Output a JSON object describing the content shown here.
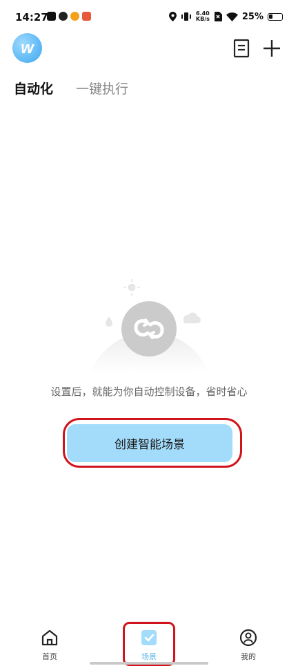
{
  "status_bar": {
    "time": "14:27",
    "net_speed_value": "6.40",
    "net_speed_unit": "KB/s",
    "battery_percent": "25%",
    "app_icons": [
      "tiktok-icon",
      "link-icon",
      "weibo-icon",
      "app-icon"
    ]
  },
  "header": {
    "logo_letter": "w"
  },
  "tabs": [
    {
      "label": "自动化",
      "active": true
    },
    {
      "label": "一键执行",
      "active": false
    }
  ],
  "empty_state": {
    "message": "设置后，就能为你自动控制设备，省时省心"
  },
  "create_button": {
    "label": "创建智能场景"
  },
  "bottom_nav": [
    {
      "label": "首页",
      "icon": "home-icon",
      "active": false
    },
    {
      "label": "场景",
      "icon": "scene-check-icon",
      "active": true
    },
    {
      "label": "我的",
      "icon": "profile-icon",
      "active": false
    }
  ],
  "colors": {
    "accent": "#5ab6ea",
    "button_bg": "#a3dcfb",
    "highlight_outline": "#d1141b"
  }
}
